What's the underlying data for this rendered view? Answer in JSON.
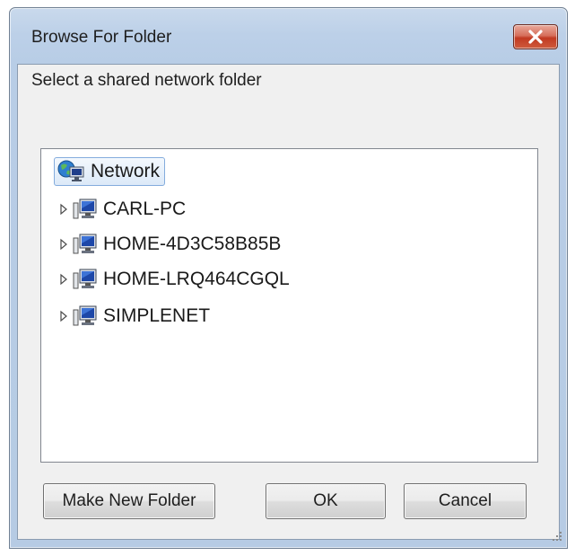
{
  "window": {
    "title": "Browse For Folder",
    "close_icon": "close-icon"
  },
  "dialog": {
    "instruction": "Select a shared network folder"
  },
  "tree": {
    "root": {
      "label": "Network",
      "icon": "network-icon",
      "selected": true
    },
    "items": [
      {
        "label": "CARL-PC",
        "icon": "computer-icon",
        "expander": "expand-arrow-icon"
      },
      {
        "label": "HOME-4D3C58B85B",
        "icon": "computer-icon",
        "expander": "expand-arrow-icon"
      },
      {
        "label": "HOME-LRQ464CGQL",
        "icon": "computer-icon",
        "expander": "expand-arrow-icon"
      },
      {
        "label": "SIMPLENET",
        "icon": "computer-icon",
        "expander": "expand-arrow-icon"
      }
    ]
  },
  "buttons": {
    "make_new_folder": "Make New Folder",
    "ok": "OK",
    "cancel": "Cancel"
  },
  "colors": {
    "title_bar": "#bcd0e8",
    "close_button": "#c13a22",
    "selection_border": "#84acdd",
    "client_background": "#f0f0f0"
  }
}
